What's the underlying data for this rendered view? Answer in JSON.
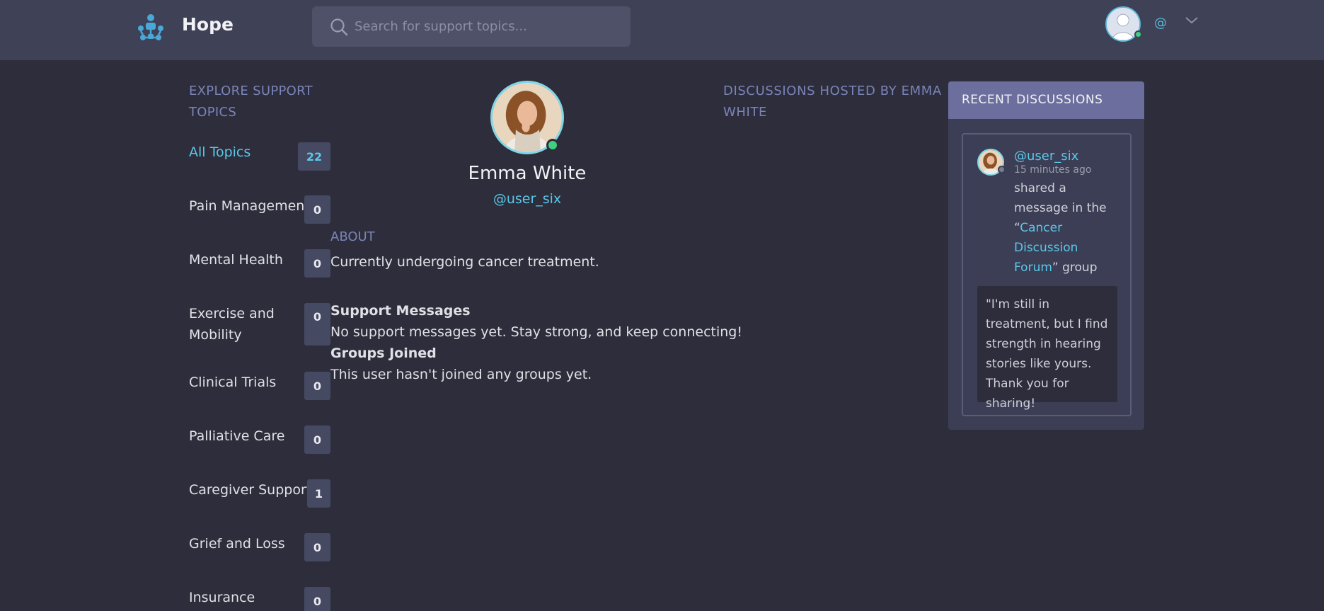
{
  "header": {
    "app_name": "Hope",
    "search_placeholder": "Search for support topics...",
    "user_handle": "@"
  },
  "sidebar": {
    "title": "EXPLORE SUPPORT TOPICS",
    "topics": [
      {
        "label": "All Topics",
        "count": "22"
      },
      {
        "label": "Pain Management",
        "count": "0"
      },
      {
        "label": "Mental Health",
        "count": "0"
      },
      {
        "label": "Exercise and Mobility",
        "count": "0"
      },
      {
        "label": "Clinical Trials",
        "count": "0"
      },
      {
        "label": "Palliative Care",
        "count": "0"
      },
      {
        "label": "Caregiver Support",
        "count": "1"
      },
      {
        "label": "Grief and Loss",
        "count": "0"
      },
      {
        "label": "Insurance",
        "count": "0"
      }
    ]
  },
  "profile": {
    "name": "Emma White",
    "handle": "@user_six",
    "about_label": "ABOUT",
    "about_text": "Currently undergoing cancer treatment.",
    "support_title": "Support Messages",
    "support_text": "No support messages yet. Stay strong, and keep connecting!",
    "groups_title": "Groups Joined",
    "groups_text": "This user hasn't joined any groups yet."
  },
  "hosted": {
    "title": "DISCUSSIONS HOSTED BY EMMA WHITE"
  },
  "recent": {
    "title": "RECENT DISCUSSIONS",
    "item": {
      "user": "@user_six",
      "time": "15 minutes ago",
      "action_prefix": "shared a message in the “",
      "group": "Cancer Discussion Forum",
      "action_suffix": "” group",
      "quote": "\"I'm still in treatment, but I find strength in hearing stories like yours. Thank you for sharing!"
    }
  },
  "colors": {
    "background": "#2d2d3b",
    "header": "#3f4157",
    "accent": "#5ac8e8",
    "muted_heading": "#7b84b8",
    "panel_header": "#6c6f9d",
    "online": "#3fd17f"
  }
}
